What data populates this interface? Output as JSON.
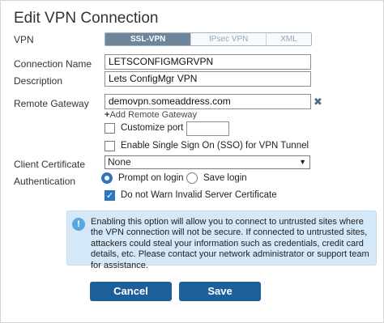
{
  "dialog": {
    "title": "Edit VPN Connection"
  },
  "vpn": {
    "label": "VPN",
    "types": [
      "SSL-VPN",
      "IPsec VPN",
      "XML"
    ],
    "selected": "SSL-VPN"
  },
  "connection_name": {
    "label": "Connection Name",
    "value": "LETSCONFIGMGRVPN"
  },
  "description": {
    "label": "Description",
    "value": "Lets ConfigMgr VPN"
  },
  "remote_gateway": {
    "label": "Remote Gateway",
    "value": "demovpn.someaddress.com",
    "remove_icon": "close-icon",
    "add_label": "Add Remote Gateway"
  },
  "customize_port": {
    "label": "Customize port",
    "checked": false,
    "value": ""
  },
  "sso": {
    "label": "Enable Single Sign On (SSO) for VPN Tunnel",
    "checked": false
  },
  "client_certificate": {
    "label": "Client Certificate",
    "value": "None"
  },
  "authentication": {
    "label": "Authentication",
    "options": [
      "Prompt on login",
      "Save login"
    ],
    "selected": "Prompt on login"
  },
  "no_warn": {
    "label": "Do not Warn Invalid Server Certificate",
    "checked": true
  },
  "notice": {
    "icon": "info-icon",
    "text": "Enabling this option will allow you to connect to untrusted sites where the VPN connection will not be secure. If connected to untrusted sites, attackers could steal your information such as credentials, credit card details, etc. Please contact your network administrator or support team for assistance."
  },
  "buttons": {
    "cancel": "Cancel",
    "save": "Save"
  },
  "colors": {
    "primary": "#1d5e9b",
    "notice_bg": "#d4e8f7",
    "check_on": "#2f74c0"
  }
}
